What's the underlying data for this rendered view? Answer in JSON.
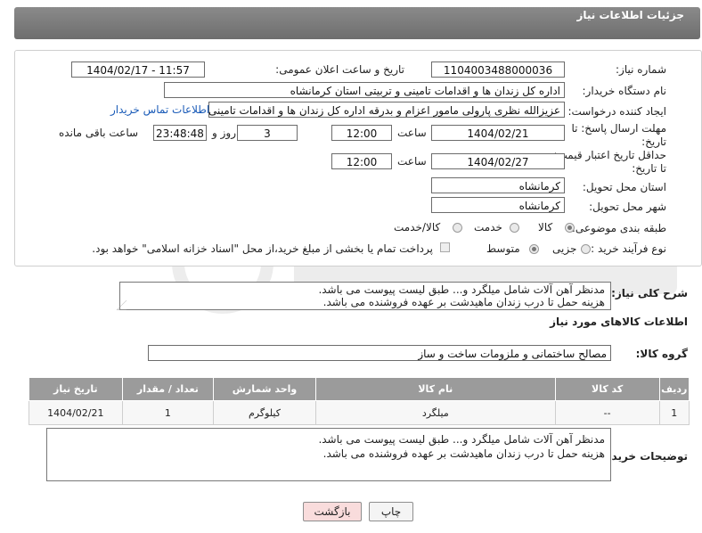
{
  "header": {
    "title": "جزئیات اطلاعات نیاز"
  },
  "form": {
    "need_number_label": "شماره نیاز:",
    "need_number": "1104003488000036",
    "announce_label": "تاریخ و ساعت اعلان عمومی:",
    "announce_value": "1404/02/17 - 11:57",
    "buyer_org_label": "نام دستگاه خریدار:",
    "buyer_org": "اداره کل زندان ها و اقدامات تامینی و تربیتی استان کرمانشاه",
    "creator_label": "ایجاد کننده درخواست:",
    "creator": "عزیزالله نظری پارولی مامور اعزام و بدرقه اداره کل زندان ها و اقدامات تامینی و تربیتی استان کرمانشاه",
    "buyer_contact_link": "اطلاعات تماس خریدار",
    "reply_deadline_label_1": "مهلت ارسال پاسخ: تا",
    "reply_deadline_label_2": "تاریخ:",
    "reply_date": "1404/02/21",
    "time_label": "ساعت",
    "reply_time": "12:00",
    "days_value": "3",
    "days_label": "روز و",
    "remaining_time": "23:48:48",
    "remaining_label": "ساعت باقی مانده",
    "price_validity_label_1": "حداقل تاریخ اعتبار قیمت:",
    "price_validity_label_2": "تا تاریخ:",
    "price_date": "1404/02/27",
    "price_time": "12:00",
    "province_label": "استان محل تحویل:",
    "province": "کرمانشاه",
    "city_label": "شهر محل تحویل:",
    "city": "کرمانشاه",
    "category_label": "طبقه بندی موضوعی:",
    "category_options": [
      "کالا",
      "خدمت",
      "کالا/خدمت"
    ],
    "purchase_type_label": "نوع فرآیند خرید :",
    "purchase_type_options": [
      "جزیی",
      "متوسط"
    ],
    "payment_note": "پرداخت تمام یا بخشی از مبلغ خرید،از محل \"اسناد خزانه اسلامی\" خواهد بود."
  },
  "description": {
    "label": "شرح کلی نیاز:",
    "line1": "مدنظر آهن آلات شامل میلگرد و... طبق لیست پیوست می باشد.",
    "line2": "هزینه حمل تا درب زندان ماهیدشت بر عهده فروشنده می باشد."
  },
  "goods": {
    "section_title": "اطلاعات کالاهای مورد نیاز",
    "group_label": "گروه کالا:",
    "group_value": "مصالح ساختمانی و ملزومات ساخت و ساز",
    "columns": [
      "ردیف",
      "کد کالا",
      "نام کالا",
      "واحد شمارش",
      "تعداد / مقدار",
      "تاریخ نیاز"
    ],
    "rows": [
      {
        "index": "1",
        "code": "--",
        "name": "میلگرد",
        "unit": "کیلوگرم",
        "qty": "1",
        "date": "1404/02/21"
      }
    ]
  },
  "buyer_notes": {
    "label": "توضیحات خریدار:",
    "line1": "مدنظر آهن آلات شامل میلگرد و... طبق لیست پیوست می باشد.",
    "line2": "هزینه حمل تا درب زندان ماهیدشت بر عهده فروشنده می باشد."
  },
  "buttons": {
    "print": "چاپ",
    "back": "بازگشت"
  },
  "colors": {
    "header_bg": "#7c7c7c",
    "link": "#1a5bb8",
    "back_button_bg": "#f9dcdc"
  }
}
